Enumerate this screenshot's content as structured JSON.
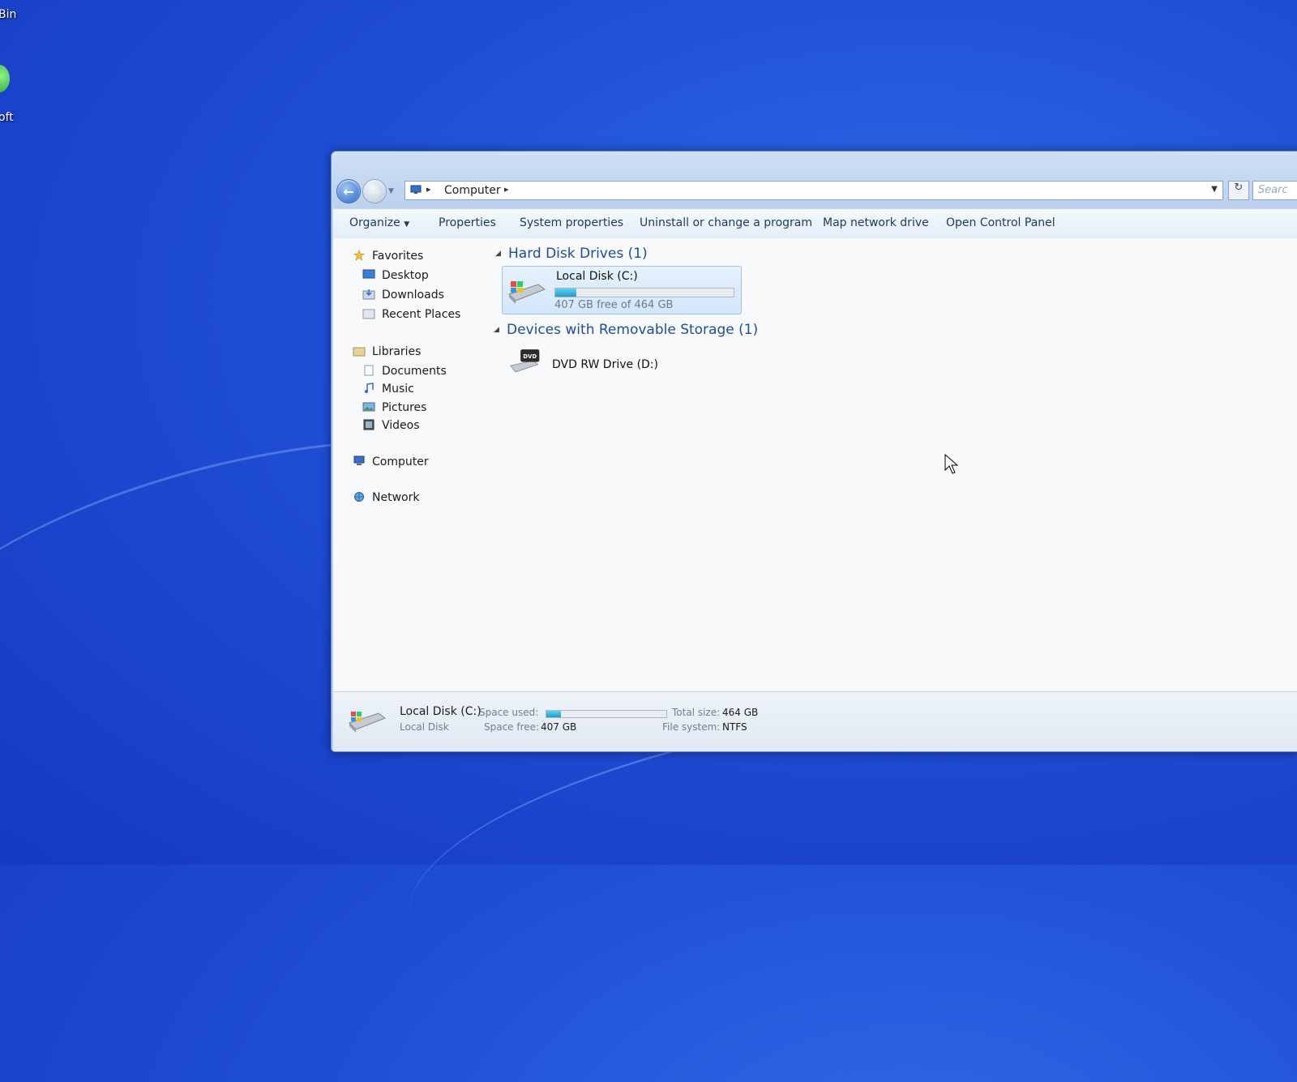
{
  "desktop": {
    "labels": [
      "Bin",
      "oft"
    ]
  },
  "window": {
    "address": {
      "crumb": "Computer",
      "search_placeholder": "Searc"
    },
    "toolbar": {
      "organize": "Organize",
      "properties": "Properties",
      "system_properties": "System properties",
      "uninstall": "Uninstall or change a program",
      "map_drive": "Map network drive",
      "control_panel": "Open Control Panel"
    },
    "nav": {
      "favorites": "Favorites",
      "desktop": "Desktop",
      "downloads": "Downloads",
      "recent": "Recent Places",
      "libraries": "Libraries",
      "documents": "Documents",
      "music": "Music",
      "pictures": "Pictures",
      "videos": "Videos",
      "computer": "Computer",
      "network": "Network"
    },
    "groups": {
      "hdd_header": "Hard Disk Drives (1)",
      "removable_header": "Devices with Removable Storage (1)"
    },
    "drives": {
      "c_name": "Local Disk (C:)",
      "c_free": "407 GB free of 464 GB",
      "c_used_fraction": 0.12,
      "d_name": "DVD RW Drive (D:)",
      "d_badge": "DVD"
    },
    "details": {
      "name": "Local Disk (C:)",
      "type": "Local Disk",
      "space_used_label": "Space used:",
      "space_free_label": "Space free:",
      "space_free_value": "407 GB",
      "total_label": "Total size:",
      "total_value": "464 GB",
      "fs_label": "File system:",
      "fs_value": "NTFS"
    }
  }
}
